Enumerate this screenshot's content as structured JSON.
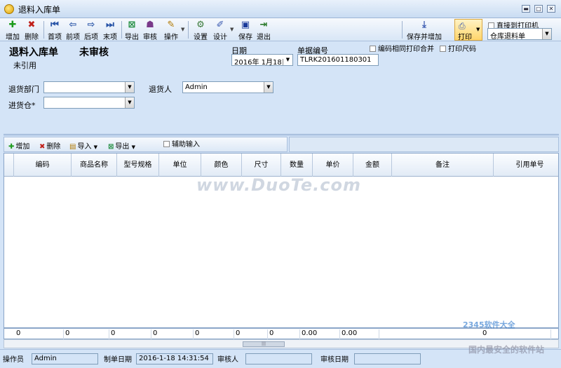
{
  "window": {
    "title": "退料入库单"
  },
  "toolbar": {
    "buttons": [
      {
        "label": "增加",
        "icon": "plus-icon",
        "glyph": "✚",
        "color": "#1a9a1a"
      },
      {
        "label": "删除",
        "icon": "delete-icon",
        "glyph": "✖",
        "color": "#c0201a"
      },
      {
        "label": "首项",
        "icon": "first-icon",
        "glyph": "⏮",
        "color": "#2a56a8"
      },
      {
        "label": "前项",
        "icon": "prev-icon",
        "glyph": "⇦",
        "color": "#2a56a8"
      },
      {
        "label": "后项",
        "icon": "next-icon",
        "glyph": "⇨",
        "color": "#2a56a8"
      },
      {
        "label": "末项",
        "icon": "last-icon",
        "glyph": "⏭",
        "color": "#2a56a8"
      },
      {
        "label": "导出",
        "icon": "export-icon",
        "glyph": "⊠",
        "color": "#1a8a3a"
      },
      {
        "label": "审核",
        "icon": "audit-icon",
        "glyph": "☗",
        "color": "#7a3a8a"
      },
      {
        "label": "操作",
        "icon": "operate-icon",
        "glyph": "✎",
        "color": "#b07800"
      },
      {
        "label": "设置",
        "icon": "settings-icon",
        "glyph": "⚙",
        "color": "#3a7a3a"
      },
      {
        "label": "设计",
        "icon": "design-icon",
        "glyph": "✐",
        "color": "#3a5ab0"
      },
      {
        "label": "保存",
        "icon": "save-icon",
        "glyph": "▣",
        "color": "#1a3a9a"
      },
      {
        "label": "退出",
        "icon": "exit-icon",
        "glyph": "⇥",
        "color": "#2a7a2a"
      }
    ],
    "save_add": "保存并增加",
    "print": "打印",
    "direct_print": "直接到打印机",
    "print_template": "仓库退料单"
  },
  "header": {
    "doc_title": "退料入库单",
    "audit_status": "未审核",
    "ref_status": "未引用",
    "date_label": "日期",
    "date_value": "2016年 1月18日",
    "doc_no_label": "单据编号",
    "doc_no_value": "TLRK201601180301",
    "merge_print": "编码相同打印合并",
    "print_size": "打印尺码",
    "dept_label": "退货部门",
    "dept_value": "",
    "person_label": "退货人",
    "person_value": "Admin",
    "warehouse_label": "进货仓*",
    "warehouse_value": ""
  },
  "grid_toolbar": {
    "add": "增加",
    "delete": "删除",
    "import": "导入",
    "export": "导出",
    "assist_input": "辅助输入"
  },
  "grid": {
    "columns": [
      "编码",
      "商品名称",
      "型号规格",
      "单位",
      "颜色",
      "尺寸",
      "数量",
      "单价",
      "金额",
      "备注",
      "引用单号"
    ]
  },
  "totals": [
    "0",
    "0",
    "0",
    "0",
    "0",
    "0",
    "0",
    "0.00",
    "0.00",
    "0"
  ],
  "watermark": "www.DuoTe.com",
  "status": {
    "operator_label": "操作员",
    "operator_value": "Admin",
    "create_date_label": "制单日期",
    "create_date_value": "2016-1-18 14:31:54",
    "auditor_label": "审核人",
    "auditor_value": "",
    "audit_date_label": "审核日期",
    "audit_date_value": ""
  },
  "brand": {
    "logo": "2345软件大全",
    "slogan": "国内最安全的软件站"
  }
}
